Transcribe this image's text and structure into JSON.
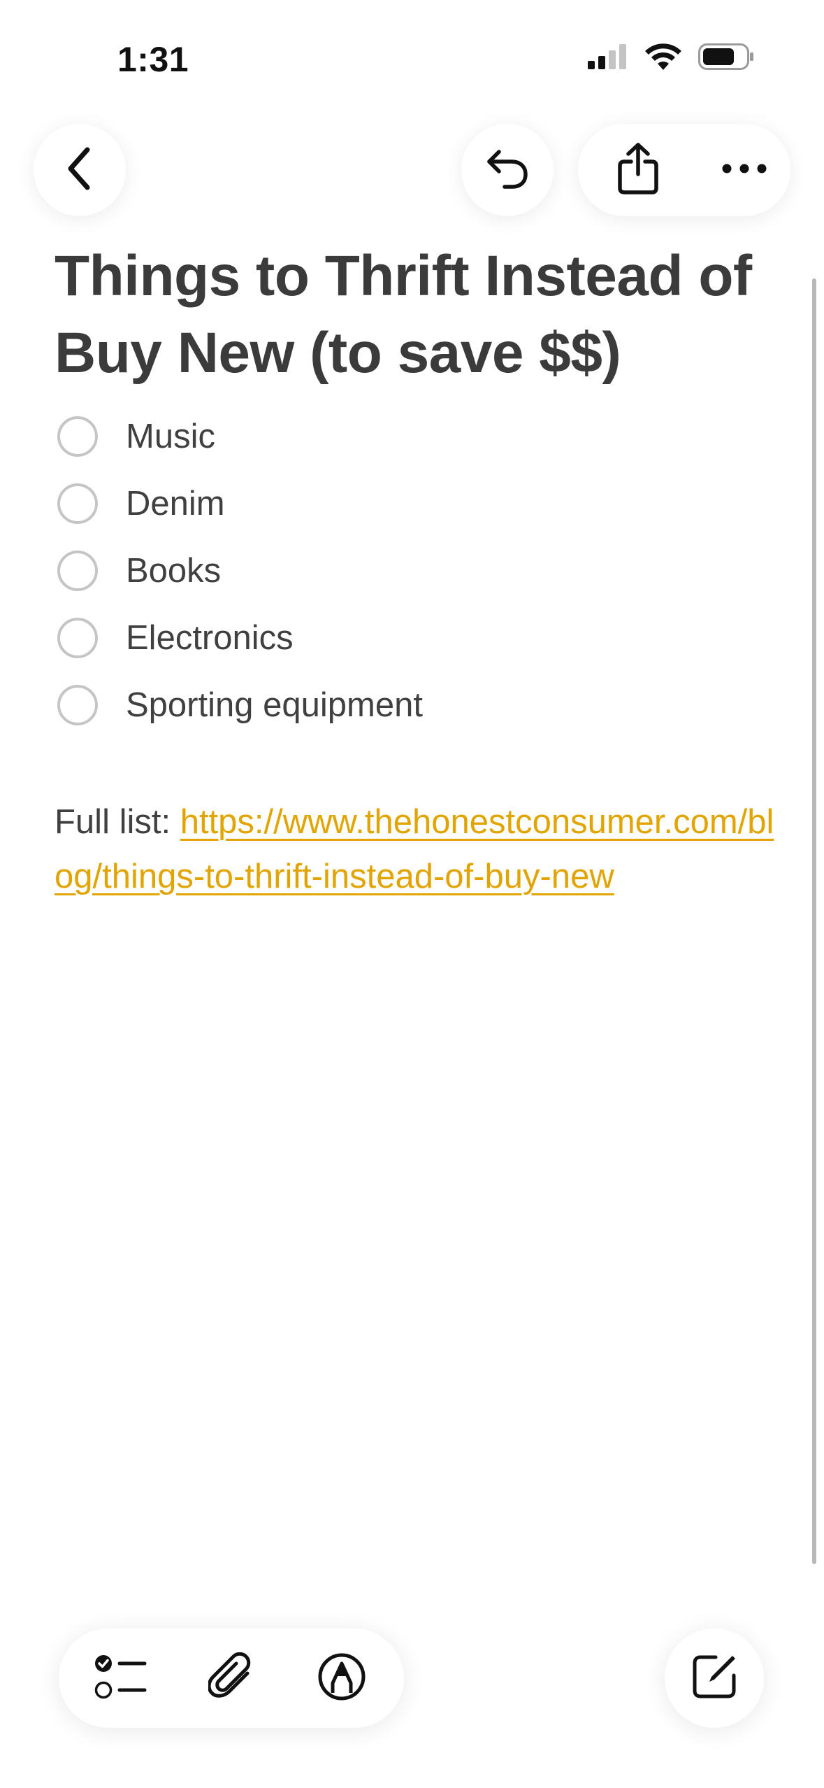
{
  "status_bar": {
    "time": "1:31",
    "icons": [
      "cellular-signal-icon",
      "wifi-icon",
      "battery-icon"
    ]
  },
  "toolbar_top": {
    "back_icon": "chevron-left-icon",
    "undo_icon": "undo-icon",
    "share_icon": "share-icon",
    "more_icon": "ellipsis-icon"
  },
  "note": {
    "title": "Things to Thrift Instead of Buy New (to save $$)",
    "checklist": [
      {
        "label": "Music",
        "checked": false
      },
      {
        "label": "Denim",
        "checked": false
      },
      {
        "label": "Books",
        "checked": false
      },
      {
        "label": "Electronics",
        "checked": false
      },
      {
        "label": "Sporting equipment",
        "checked": false
      }
    ],
    "full_list_prefix": "Full list: ",
    "full_list_url": "https://www.thehonestconsumer.com/blog/things-to-thrift-instead-of-buy-new"
  },
  "toolbar_bottom": {
    "checklist_icon": "checklist-icon",
    "attachment_icon": "paperclip-icon",
    "markup_icon": "markup-pen-icon",
    "compose_icon": "compose-icon"
  },
  "colors": {
    "link": "#e2a400",
    "text": "#404040",
    "checkbox_border": "#c5c5c5"
  }
}
